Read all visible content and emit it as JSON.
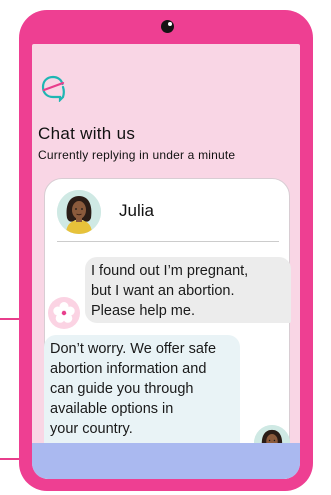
{
  "header": {
    "title": "Chat with us",
    "subtitle": "Currently replying in under a minute"
  },
  "agent": {
    "name": "Julia"
  },
  "messages": {
    "user": [
      "I found out I’m pregnant,",
      "but I want an abortion.",
      "Please help me."
    ],
    "agent": [
      "Don’t worry. We offer safe",
      "abortion information and",
      "can guide you through",
      "available options in",
      "your country."
    ]
  },
  "colors": {
    "phone_frame": "#ee3f92",
    "screen_bg": "#f9d6e5",
    "user_bubble": "#ececec",
    "agent_bubble": "#e9f3f6",
    "footer": "#aab9f0",
    "logo_teal": "#1fb6b3",
    "logo_pink": "#e83e8c"
  },
  "icons": {
    "logo": "chat-bubble-logo-icon",
    "user_avatar": "flower-icon",
    "camera": "camera-icon"
  }
}
